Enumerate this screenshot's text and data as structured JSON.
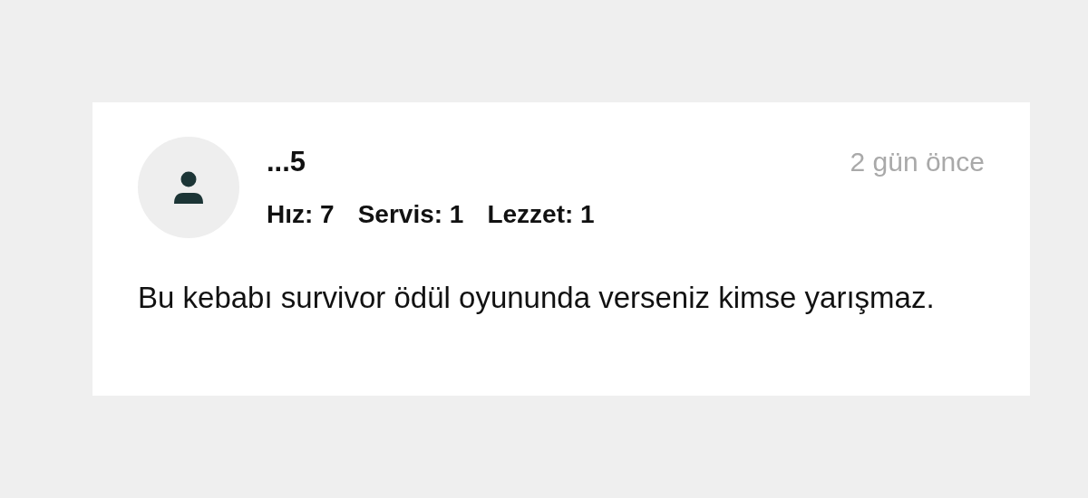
{
  "review": {
    "author": "...5",
    "time": "2 gün önce",
    "ratings": [
      "Hız: 7",
      "Servis: 1",
      "Lezzet: 1"
    ],
    "text": "Bu kebabı survivor ödül oyununda verseniz kimse yarışmaz."
  }
}
